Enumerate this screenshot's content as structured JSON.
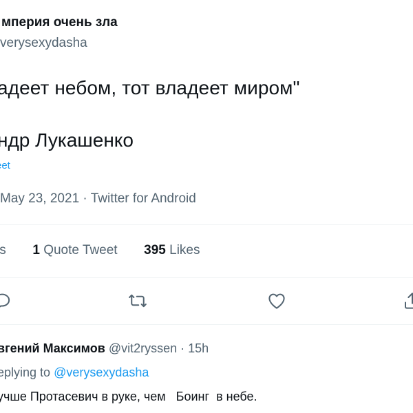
{
  "author": {
    "name": "мперия очень зла",
    "handle": "verysexydasha"
  },
  "tweet": {
    "line1": "адеет небом, тот владеет миром\"",
    "line2": "ндр Лукашенко",
    "translate_label": "eet"
  },
  "meta": {
    "date": "May 23, 2021",
    "separator": "·",
    "source": "Twitter for Android"
  },
  "stats": {
    "retweets_label": "ts",
    "quote_count": "1",
    "quote_label": "Quote Tweet",
    "likes_count": "395",
    "likes_label": "Likes"
  },
  "actions": {
    "icons": [
      "reply-icon",
      "retweet-icon",
      "like-icon",
      "share-icon"
    ]
  },
  "reply": {
    "name": "вгений Максимов",
    "handle": "@vit2ryssen",
    "separator": "·",
    "time": "15h",
    "replying_prefix": "eplying to",
    "replying_mention": "@verysexydasha",
    "text": "учше Протасевич в руке, чем   Боинг  в небе."
  },
  "colors": {
    "text": "#0f1419",
    "secondary": "#536471",
    "accent": "#1d9bf0",
    "divider": "#eff3f4"
  }
}
